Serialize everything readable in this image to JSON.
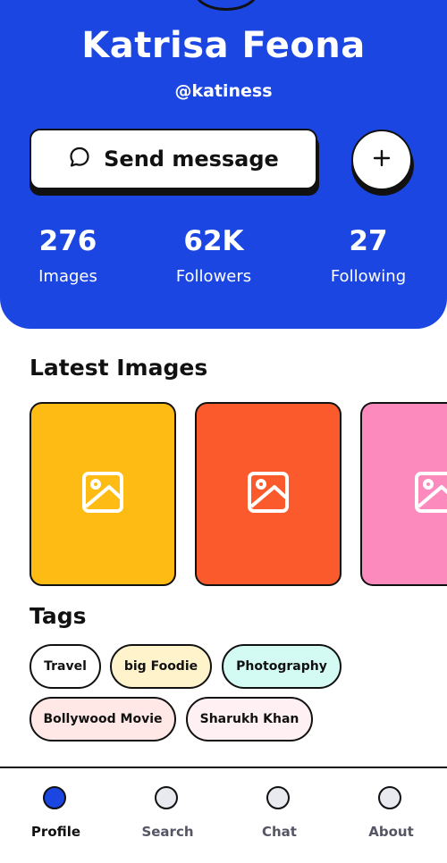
{
  "profile": {
    "name": "Katrisa Feona",
    "handle": "@katiness"
  },
  "actions": {
    "send_message_label": "Send message",
    "send_icon": "chat-bubble-icon",
    "add_icon": "plus-icon"
  },
  "stats": [
    {
      "value": "276",
      "label": "Images"
    },
    {
      "value": "62K",
      "label": "Followers"
    },
    {
      "value": "27",
      "label": "Following"
    }
  ],
  "latest_images": {
    "title": "Latest Images",
    "items": [
      {
        "color": "#fdbb13",
        "icon": "image-icon"
      },
      {
        "color": "#fb5a2c",
        "icon": "image-icon"
      },
      {
        "color": "#fd8abd",
        "icon": "image-icon"
      }
    ]
  },
  "tags": {
    "title": "Tags",
    "items": [
      {
        "label": "Travel",
        "color": "#ffffff"
      },
      {
        "label": "big Foodie",
        "color": "#fff3cc"
      },
      {
        "label": "Photography",
        "color": "#d3faf3"
      },
      {
        "label": "Bollywood Movie",
        "color": "#ffe8e6"
      },
      {
        "label": "Sharukh Khan",
        "color": "#fff1f3"
      }
    ]
  },
  "nav": {
    "items": [
      {
        "label": "Profile",
        "active": true
      },
      {
        "label": "Search",
        "active": false
      },
      {
        "label": "Chat",
        "active": false
      },
      {
        "label": "About",
        "active": false
      }
    ]
  },
  "colors": {
    "brand": "#1b46e2",
    "inactive_dot": "#e8eaf0",
    "inactive_text": "#555566"
  }
}
